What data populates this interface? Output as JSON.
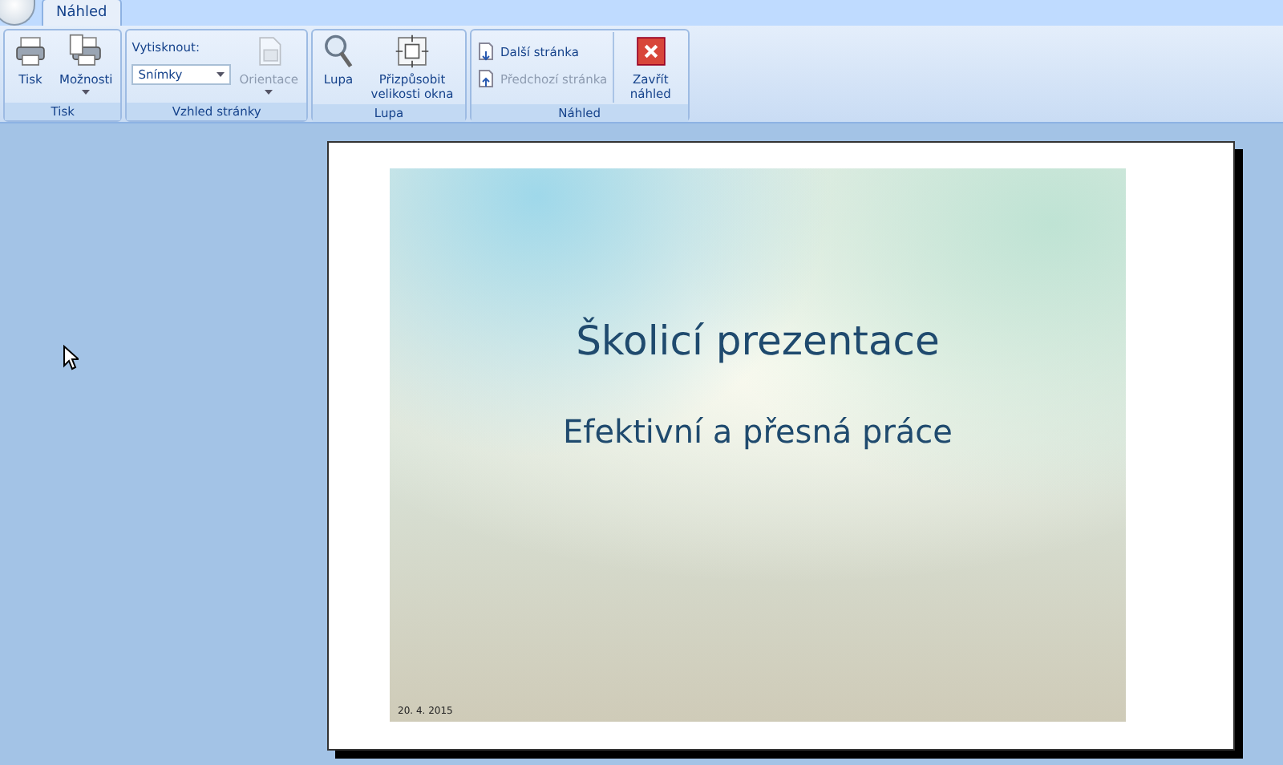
{
  "tabs": [
    {
      "label": "Náhled",
      "selected": true
    }
  ],
  "ribbon": {
    "groups": [
      {
        "label": "Tisk",
        "controls": [
          {
            "kind": "large",
            "label": "Tisk",
            "disabled": false,
            "has_caret": false
          },
          {
            "kind": "large",
            "label": "Možnosti",
            "disabled": false,
            "has_caret": true
          }
        ]
      },
      {
        "label": "Vzhled stránky",
        "controls": [
          {
            "kind": "dropdown",
            "label": "Vytisknout:",
            "value": "Snímky",
            "disabled": false
          },
          {
            "kind": "large",
            "label": "Orientace",
            "disabled": true,
            "has_caret": true
          }
        ]
      },
      {
        "label": "Lupa",
        "controls": [
          {
            "kind": "large",
            "label": "Lupa",
            "disabled": false,
            "has_caret": false
          },
          {
            "kind": "large",
            "label": "Přizpůsobit velikosti okna",
            "disabled": false,
            "has_caret": false
          }
        ]
      },
      {
        "label": "Náhled",
        "controls": [
          {
            "kind": "small_stack",
            "items": [
              {
                "label": "Další stránka",
                "disabled": false
              },
              {
                "label": "Předchozí stránka",
                "disabled": true
              }
            ]
          },
          {
            "kind": "large",
            "label": "Zavřít náhled",
            "disabled": false,
            "has_caret": false
          }
        ]
      }
    ]
  },
  "slide": {
    "title": "Školicí prezentace",
    "subtitle": "Efektivní a přesná práce",
    "date": "20. 4. 2015"
  }
}
